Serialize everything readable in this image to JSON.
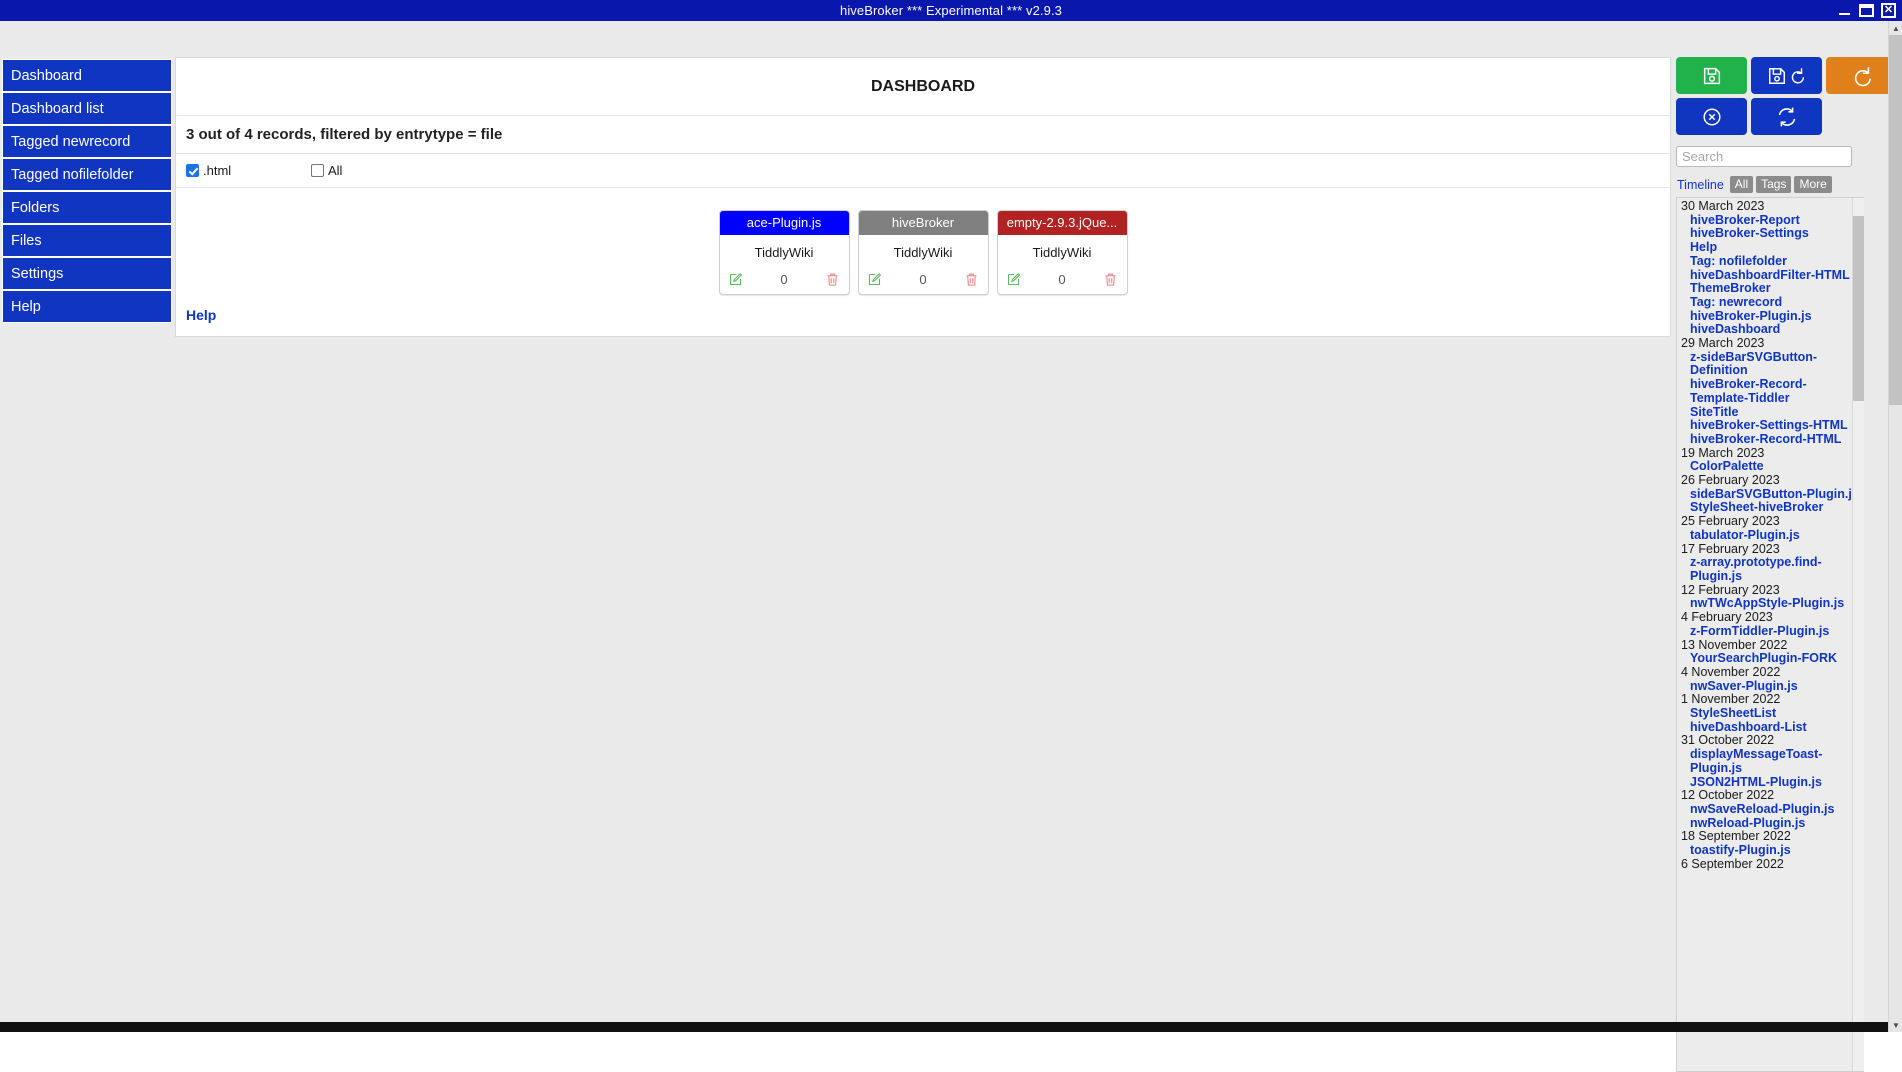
{
  "window": {
    "title": "hiveBroker *** Experimental *** v2.9.3",
    "minimize_label": "minimize",
    "maximize_label": "maximize",
    "close_label": "✕"
  },
  "sidebar": {
    "items": [
      {
        "label": "Dashboard"
      },
      {
        "label": "Dashboard list"
      },
      {
        "label": "Tagged newrecord"
      },
      {
        "label": "Tagged nofilefolder"
      },
      {
        "label": "Folders"
      },
      {
        "label": "Files"
      },
      {
        "label": "Settings"
      },
      {
        "label": "Help"
      }
    ]
  },
  "main": {
    "title": "DASHBOARD",
    "subtitle": "3 out of 4 records, filtered by entrytype = file",
    "filters": [
      {
        "label": ".html",
        "checked": true
      },
      {
        "label": "All",
        "checked": false
      }
    ],
    "cards": [
      {
        "title": "ace-Plugin.js",
        "color": "#0000ff",
        "subtitle": "TiddlyWiki",
        "count": "0"
      },
      {
        "title": "hiveBroker",
        "color": "#808080",
        "subtitle": "TiddlyWiki",
        "count": "0"
      },
      {
        "title": "empty-2.9.3.jQue...",
        "color": "#b22222",
        "subtitle": "TiddlyWiki",
        "count": "0"
      }
    ],
    "help_label": "Help"
  },
  "toolbar": {
    "buttons": [
      {
        "name": "save-button",
        "icon": "floppy-disk-icon",
        "color": "#22b24c"
      },
      {
        "name": "save-reload-button",
        "icon": "floppy-disk-reload-icon",
        "color": "#1035c0"
      },
      {
        "name": "reload-button",
        "icon": "reload-icon",
        "color": "#e0801a"
      },
      {
        "name": "cancel-button",
        "icon": "x-circle-icon",
        "color": "#1035c0"
      },
      {
        "name": "refresh-button",
        "icon": "refresh-icon",
        "color": "#1035c0"
      }
    ]
  },
  "search": {
    "value": "",
    "placeholder": "Search"
  },
  "right_tabs": {
    "active": "Timeline",
    "buttons": [
      "All",
      "Tags",
      "More"
    ]
  },
  "timeline": [
    {
      "date": "30 March 2023",
      "entries": [
        "hiveBroker-Report",
        "hiveBroker-Settings",
        "Help",
        "Tag: nofilefolder",
        "hiveDashboardFilter-HTML",
        "ThemeBroker",
        "Tag: newrecord",
        "hiveBroker-Plugin.js",
        "hiveDashboard"
      ]
    },
    {
      "date": "29 March 2023",
      "entries": [
        "z-sideBarSVGButton-Definition",
        "hiveBroker-Record-Template-Tiddler",
        "SiteTitle",
        "hiveBroker-Settings-HTML",
        "hiveBroker-Record-HTML"
      ]
    },
    {
      "date": "19 March 2023",
      "entries": [
        "ColorPalette"
      ]
    },
    {
      "date": "26 February 2023",
      "entries": [
        "sideBarSVGButton-Plugin.js",
        "StyleSheet-hiveBroker"
      ]
    },
    {
      "date": "25 February 2023",
      "entries": [
        "tabulator-Plugin.js"
      ]
    },
    {
      "date": "17 February 2023",
      "entries": [
        "z-array.prototype.find-Plugin.js"
      ]
    },
    {
      "date": "12 February 2023",
      "entries": [
        "nwTWcAppStyle-Plugin.js"
      ]
    },
    {
      "date": "4 February 2023",
      "entries": [
        "z-FormTiddler-Plugin.js"
      ]
    },
    {
      "date": "13 November 2022",
      "entries": [
        "YourSearchPlugin-FORK"
      ]
    },
    {
      "date": "4 November 2022",
      "entries": [
        "nwSaver-Plugin.js"
      ]
    },
    {
      "date": "1 November 2022",
      "entries": [
        "StyleSheetList",
        "hiveDashboard-List"
      ]
    },
    {
      "date": "31 October 2022",
      "entries": [
        "displayMessageToast-Plugin.js",
        "JSON2HTML-Plugin.js"
      ]
    },
    {
      "date": "12 October 2022",
      "entries": [
        "nwSaveReload-Plugin.js",
        "nwReload-Plugin.js"
      ]
    },
    {
      "date": "18 September 2022",
      "entries": [
        "toastify-Plugin.js"
      ]
    },
    {
      "date": "6 September 2022",
      "entries": []
    }
  ]
}
